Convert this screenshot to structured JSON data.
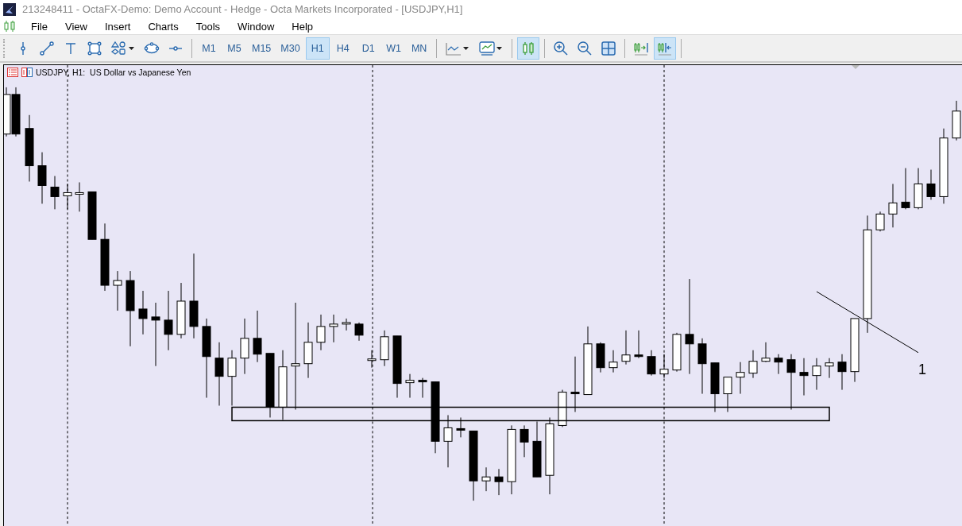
{
  "window": {
    "title": "213248411 - OctaFX-Demo: Demo Account - Hedge - Octa Markets Incorporated - [USDJPY,H1]"
  },
  "menu": [
    "File",
    "View",
    "Insert",
    "Charts",
    "Tools",
    "Window",
    "Help"
  ],
  "toolbar": {
    "timeframes": [
      {
        "label": "M1",
        "selected": false
      },
      {
        "label": "M5",
        "selected": false
      },
      {
        "label": "M15",
        "selected": false
      },
      {
        "label": "M30",
        "selected": false
      },
      {
        "label": "H1",
        "selected": true
      },
      {
        "label": "H4",
        "selected": false
      },
      {
        "label": "D1",
        "selected": false
      },
      {
        "label": "W1",
        "selected": false
      },
      {
        "label": "MN",
        "selected": false
      }
    ],
    "toggles": {
      "candlesticks": true,
      "autoscroll": false,
      "chart_shift": true
    }
  },
  "chart": {
    "symbol_label": "USDJPY, H1:  US Dollar vs Japanese Yen",
    "annotation": "1"
  }
}
